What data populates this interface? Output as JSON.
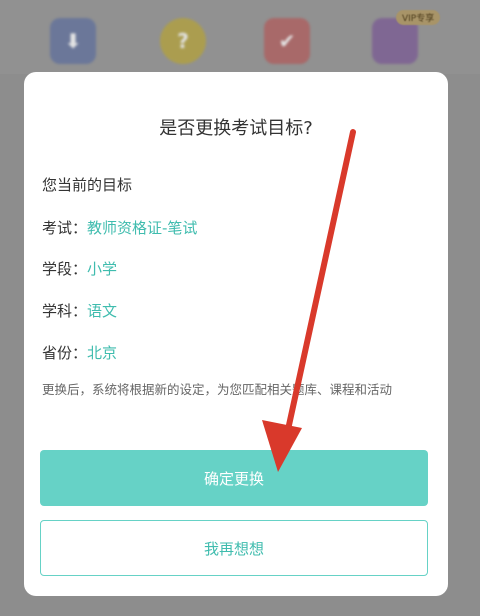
{
  "background_apps": {
    "icons": [
      {
        "name": "download-icon",
        "glyph": "⬇"
      },
      {
        "name": "question-icon",
        "glyph": "?"
      },
      {
        "name": "checkmark-icon",
        "glyph": "✔"
      },
      {
        "name": "book-icon",
        "glyph": ""
      }
    ],
    "vip_badge": "VIP专享"
  },
  "dialog": {
    "title": "是否更换考试目标?",
    "section_title": "您当前的目标",
    "rows": [
      {
        "label": "考试：",
        "value": "教师资格证-笔试"
      },
      {
        "label": "学段：",
        "value": "小学"
      },
      {
        "label": "学科：",
        "value": "语文"
      },
      {
        "label": "省份：",
        "value": "北京"
      }
    ],
    "note": "更换后，系统将根据新的设定，为您匹配相关题库、课程和活动",
    "confirm_label": "确定更换",
    "reconsider_label": "我再想想"
  },
  "colors": {
    "accent": "#66d2c6",
    "accent_text": "#3fbcae",
    "annotation_arrow": "#d9392b"
  }
}
